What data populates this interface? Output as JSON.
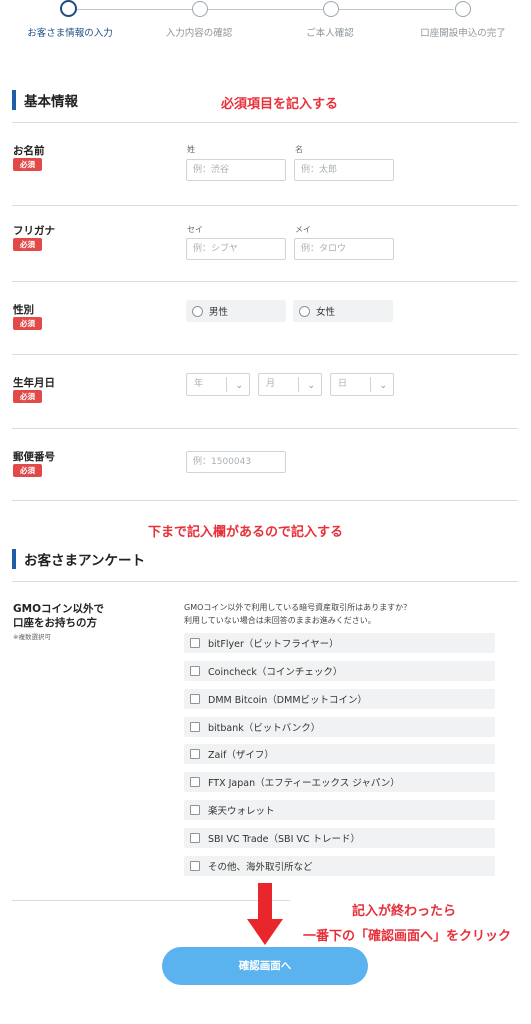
{
  "stepper": {
    "steps": [
      {
        "label": "お客さま情報の入力"
      },
      {
        "label": "入力内容の確認"
      },
      {
        "label": "ご本人確認"
      },
      {
        "label": "口座開設申込の完了"
      }
    ]
  },
  "annotations": {
    "top": "必須項目を記入する",
    "middle": "下まで記入欄があるので記入する",
    "bottom_line1": "記入が終わったら",
    "bottom_line2": "一番下の「確認画面へ」をクリック"
  },
  "basic_info": {
    "title": "基本情報",
    "required_badge": "必須",
    "name": {
      "label": "お名前",
      "last_label": "姓",
      "last_placeholder": "例：渋谷",
      "first_label": "名",
      "first_placeholder": "例：太郎"
    },
    "kana": {
      "label": "フリガナ",
      "last_label": "セイ",
      "last_placeholder": "例：シブヤ",
      "first_label": "メイ",
      "first_placeholder": "例：タロウ"
    },
    "gender": {
      "label": "性別",
      "male": "男性",
      "female": "女性"
    },
    "birthday": {
      "label": "生年月日",
      "year": "年",
      "month": "月",
      "day": "日"
    },
    "postal": {
      "label": "郵便番号",
      "placeholder": "例：1500043"
    }
  },
  "survey": {
    "title": "お客さまアンケート",
    "row_label_line1": "GMOコイン以外で",
    "row_label_line2": "口座をお持ちの方",
    "row_note": "※複数選択可",
    "question_line1": "GMOコイン以外で利用している暗号資産取引所はありますか？",
    "question_line2": "利用していない場合は未回答のままお進みください。",
    "options": [
      "bitFlyer（ビットフライヤー）",
      "Coincheck（コインチェック）",
      "DMM Bitcoin（DMMビットコイン）",
      "bitbank（ビットバンク）",
      "Zaif（ザイフ）",
      "FTX Japan（エフティーエックス ジャパン）",
      "楽天ウォレット",
      "SBI VC Trade（SBI VC トレード）",
      "その他、海外取引所など"
    ]
  },
  "confirm_button": "確認画面へ",
  "colors": {
    "accent": "#1e5ea8",
    "required": "#e24a4a",
    "annotation": "#e8303b",
    "button": "#5ab3ee",
    "arrow": "#e8262c"
  }
}
